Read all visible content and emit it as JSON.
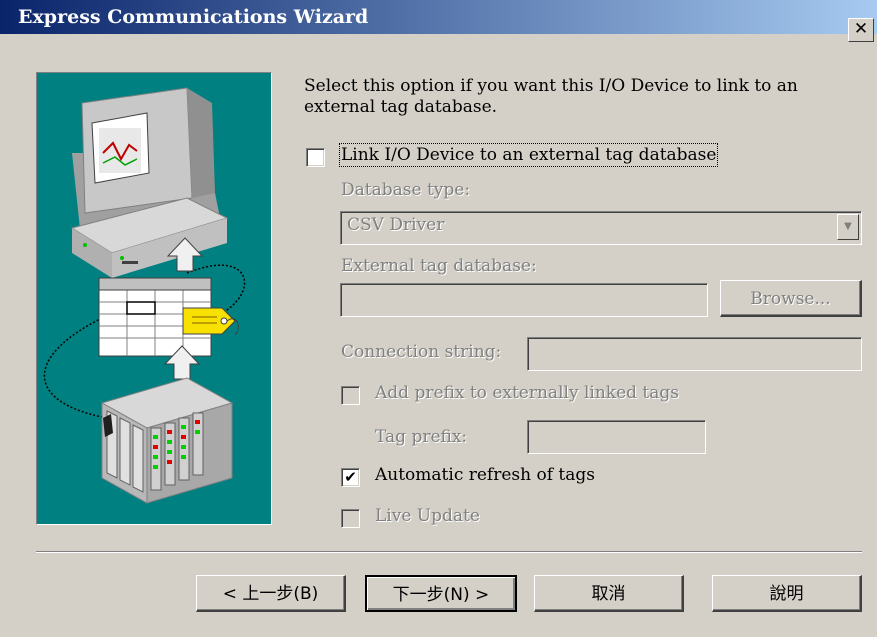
{
  "window": {
    "title": "Express Communications Wizard",
    "close_glyph": "✕"
  },
  "description": "Select this option if you want this I/O Device to link to an external tag database.",
  "link_checkbox": {
    "label": "Link I/O Device to an external tag database",
    "checked": false
  },
  "database_type": {
    "label": "Database type:",
    "value": "CSV Driver"
  },
  "external_db": {
    "label": "External tag database:",
    "value": "",
    "browse_label": "Browse..."
  },
  "connection_string": {
    "label": "Connection string:",
    "value": ""
  },
  "add_prefix": {
    "label": "Add prefix to externally linked tags",
    "checked": false
  },
  "tag_prefix": {
    "label": "Tag prefix:",
    "value": ""
  },
  "auto_refresh": {
    "label": "Automatic refresh of tags",
    "checked": true,
    "check_glyph": "✔"
  },
  "live_update": {
    "label": "Live Update",
    "checked": false
  },
  "buttons": {
    "back": "< 上一步(B)",
    "next": "下一步(N) >",
    "cancel": "取消",
    "help": "說明"
  },
  "colors": {
    "title_start": "#0a246a",
    "title_end": "#a6caf0",
    "panel": "#008080",
    "face": "#d4d0c8"
  },
  "icons": [
    "computer-monitor-icon",
    "database-table-icon",
    "tag-icon",
    "io-rack-icon",
    "up-arrow-icon"
  ]
}
